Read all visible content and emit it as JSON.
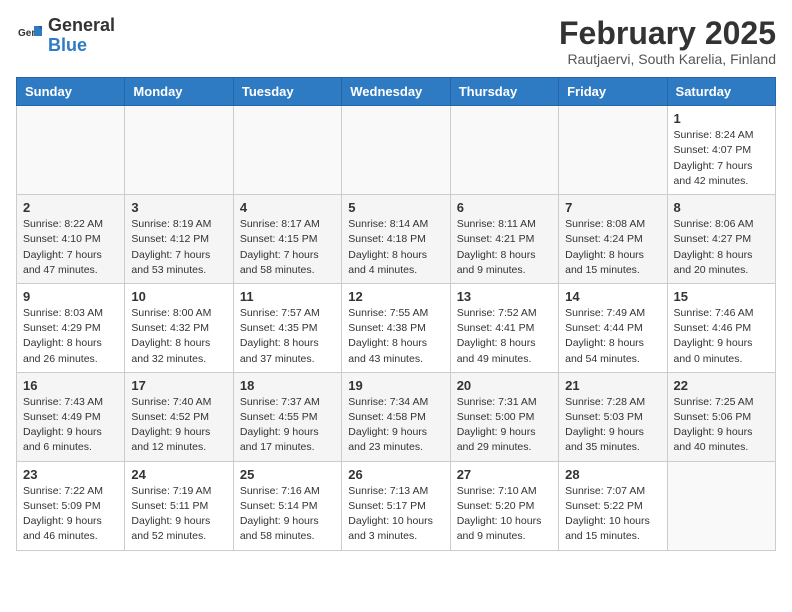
{
  "header": {
    "logo_general": "General",
    "logo_blue": "Blue",
    "month": "February 2025",
    "location": "Rautjaervi, South Karelia, Finland"
  },
  "days_of_week": [
    "Sunday",
    "Monday",
    "Tuesday",
    "Wednesday",
    "Thursday",
    "Friday",
    "Saturday"
  ],
  "weeks": [
    [
      {
        "num": "",
        "info": ""
      },
      {
        "num": "",
        "info": ""
      },
      {
        "num": "",
        "info": ""
      },
      {
        "num": "",
        "info": ""
      },
      {
        "num": "",
        "info": ""
      },
      {
        "num": "",
        "info": ""
      },
      {
        "num": "1",
        "info": "Sunrise: 8:24 AM\nSunset: 4:07 PM\nDaylight: 7 hours\nand 42 minutes."
      }
    ],
    [
      {
        "num": "2",
        "info": "Sunrise: 8:22 AM\nSunset: 4:10 PM\nDaylight: 7 hours\nand 47 minutes."
      },
      {
        "num": "3",
        "info": "Sunrise: 8:19 AM\nSunset: 4:12 PM\nDaylight: 7 hours\nand 53 minutes."
      },
      {
        "num": "4",
        "info": "Sunrise: 8:17 AM\nSunset: 4:15 PM\nDaylight: 7 hours\nand 58 minutes."
      },
      {
        "num": "5",
        "info": "Sunrise: 8:14 AM\nSunset: 4:18 PM\nDaylight: 8 hours\nand 4 minutes."
      },
      {
        "num": "6",
        "info": "Sunrise: 8:11 AM\nSunset: 4:21 PM\nDaylight: 8 hours\nand 9 minutes."
      },
      {
        "num": "7",
        "info": "Sunrise: 8:08 AM\nSunset: 4:24 PM\nDaylight: 8 hours\nand 15 minutes."
      },
      {
        "num": "8",
        "info": "Sunrise: 8:06 AM\nSunset: 4:27 PM\nDaylight: 8 hours\nand 20 minutes."
      }
    ],
    [
      {
        "num": "9",
        "info": "Sunrise: 8:03 AM\nSunset: 4:29 PM\nDaylight: 8 hours\nand 26 minutes."
      },
      {
        "num": "10",
        "info": "Sunrise: 8:00 AM\nSunset: 4:32 PM\nDaylight: 8 hours\nand 32 minutes."
      },
      {
        "num": "11",
        "info": "Sunrise: 7:57 AM\nSunset: 4:35 PM\nDaylight: 8 hours\nand 37 minutes."
      },
      {
        "num": "12",
        "info": "Sunrise: 7:55 AM\nSunset: 4:38 PM\nDaylight: 8 hours\nand 43 minutes."
      },
      {
        "num": "13",
        "info": "Sunrise: 7:52 AM\nSunset: 4:41 PM\nDaylight: 8 hours\nand 49 minutes."
      },
      {
        "num": "14",
        "info": "Sunrise: 7:49 AM\nSunset: 4:44 PM\nDaylight: 8 hours\nand 54 minutes."
      },
      {
        "num": "15",
        "info": "Sunrise: 7:46 AM\nSunset: 4:46 PM\nDaylight: 9 hours\nand 0 minutes."
      }
    ],
    [
      {
        "num": "16",
        "info": "Sunrise: 7:43 AM\nSunset: 4:49 PM\nDaylight: 9 hours\nand 6 minutes."
      },
      {
        "num": "17",
        "info": "Sunrise: 7:40 AM\nSunset: 4:52 PM\nDaylight: 9 hours\nand 12 minutes."
      },
      {
        "num": "18",
        "info": "Sunrise: 7:37 AM\nSunset: 4:55 PM\nDaylight: 9 hours\nand 17 minutes."
      },
      {
        "num": "19",
        "info": "Sunrise: 7:34 AM\nSunset: 4:58 PM\nDaylight: 9 hours\nand 23 minutes."
      },
      {
        "num": "20",
        "info": "Sunrise: 7:31 AM\nSunset: 5:00 PM\nDaylight: 9 hours\nand 29 minutes."
      },
      {
        "num": "21",
        "info": "Sunrise: 7:28 AM\nSunset: 5:03 PM\nDaylight: 9 hours\nand 35 minutes."
      },
      {
        "num": "22",
        "info": "Sunrise: 7:25 AM\nSunset: 5:06 PM\nDaylight: 9 hours\nand 40 minutes."
      }
    ],
    [
      {
        "num": "23",
        "info": "Sunrise: 7:22 AM\nSunset: 5:09 PM\nDaylight: 9 hours\nand 46 minutes."
      },
      {
        "num": "24",
        "info": "Sunrise: 7:19 AM\nSunset: 5:11 PM\nDaylight: 9 hours\nand 52 minutes."
      },
      {
        "num": "25",
        "info": "Sunrise: 7:16 AM\nSunset: 5:14 PM\nDaylight: 9 hours\nand 58 minutes."
      },
      {
        "num": "26",
        "info": "Sunrise: 7:13 AM\nSunset: 5:17 PM\nDaylight: 10 hours\nand 3 minutes."
      },
      {
        "num": "27",
        "info": "Sunrise: 7:10 AM\nSunset: 5:20 PM\nDaylight: 10 hours\nand 9 minutes."
      },
      {
        "num": "28",
        "info": "Sunrise: 7:07 AM\nSunset: 5:22 PM\nDaylight: 10 hours\nand 15 minutes."
      },
      {
        "num": "",
        "info": ""
      }
    ]
  ]
}
